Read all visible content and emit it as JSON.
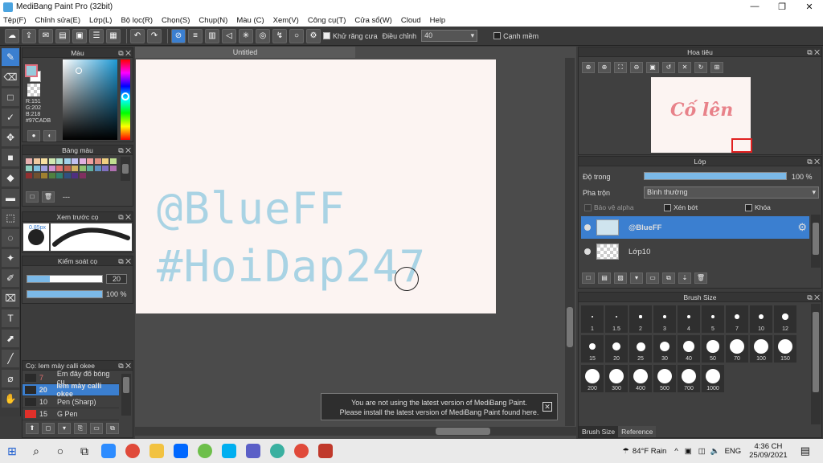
{
  "window": {
    "title": "MediBang Paint Pro (32bit)",
    "min": "—",
    "max": "❐",
    "close": "✕"
  },
  "menu": [
    "Tệp(F)",
    "Chỉnh sửa(E)",
    "Lớp(L)",
    "Bộ lọc(R)",
    "Chọn(S)",
    "Chụp(N)",
    "Màu (C)",
    "Xem(V)",
    "Công cụ(T)",
    "Cửa sổ(W)",
    "Cloud",
    "Help"
  ],
  "toolbar": {
    "antialias_label": "Khử răng cưa",
    "adjust_label": "Điều chỉnh",
    "adjust_value": "40",
    "edge_label": "Cạnh mềm"
  },
  "document": {
    "tab_title": "Untitled",
    "line1": "@BlueFF",
    "line2": "#HoiDap247"
  },
  "toast": {
    "line1": "You are not using the latest version of MediBang Paint.",
    "line2": "Please install the latest version of MediBang Paint found here.",
    "close": "✕"
  },
  "color_panel": {
    "title": "Màu",
    "r": "R:151",
    "g": "G:202",
    "b": "B:218",
    "hex": "#97CADB"
  },
  "palette_panel": {
    "title": "Bảng màu",
    "extra": "---"
  },
  "preview_panel": {
    "title": "Xem trước cọ",
    "size_label": "0.85px"
  },
  "brush_control": {
    "title": "Kiểm soát cọ",
    "size": "20",
    "opacity": "100 %",
    "size_fill": 0.3,
    "opacity_fill": 1.0
  },
  "brush_list": {
    "title": "Cọ: Iem mày calli okee",
    "items": [
      {
        "num": "7",
        "name": "Em đây đổ bóng cu",
        "selected": false,
        "color": "#2a2a2a"
      },
      {
        "num": "20",
        "name": "Iem mày calli okee",
        "selected": true,
        "color": "#2a2a2a"
      },
      {
        "num": "10",
        "name": "Pen (Sharp)",
        "selected": false,
        "color": "#2a2a2a"
      },
      {
        "num": "15",
        "name": "G Pen",
        "selected": false,
        "color": "#e0302a"
      }
    ]
  },
  "navigator": {
    "title": "Hoa tiêu",
    "preview_text": "Cố lên"
  },
  "layers": {
    "title": "Lớp",
    "opacity_label": "Độ trong",
    "opacity_value": "100 %",
    "blend_label": "Pha trộn",
    "blend_value": "Bình thường",
    "protect_alpha": "Bảo vệ alpha",
    "clipping": "Xén bớt",
    "lock": "Khóa",
    "items": [
      {
        "name": "@BlueFF",
        "selected": true
      },
      {
        "name": "Lớp10",
        "selected": false
      }
    ]
  },
  "brush_size": {
    "title": "Brush Size",
    "sizes": [
      "1",
      "1.5",
      "2",
      "3",
      "4",
      "5",
      "7",
      "10",
      "12",
      "15",
      "20",
      "25",
      "30",
      "40",
      "50",
      "70",
      "100",
      "150",
      "200",
      "300",
      "400",
      "500",
      "700",
      "1000"
    ],
    "tabs": [
      "Brush Size",
      "Reference"
    ]
  },
  "taskbar": {
    "weather": "84°F  Rain",
    "lang": "ENG",
    "time": "4:36 CH",
    "date": "25/09/2021"
  }
}
